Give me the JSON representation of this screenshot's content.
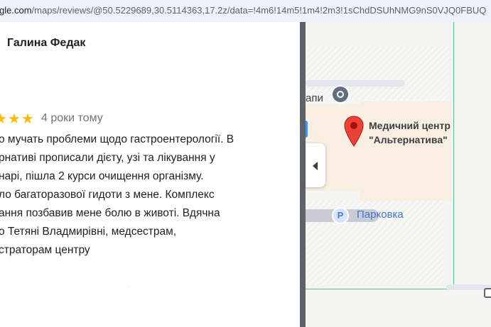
{
  "browser": {
    "url_host_part": "gle.com",
    "url_path_part": "/maps/reviews/@50.5229689,30.5114363,17.2z/data=!4m6!14m5!1m4!2m3!1sChdDSUhNMG9nS0VJQ0FBUQ"
  },
  "review": {
    "author": "Галина Федак",
    "stars": "★★★",
    "rating_icon": "star-icon",
    "date": "4 роки тому",
    "lines": [
      "о мучать проблеми щодо гастроентерології. В",
      "рнативі прописали дієту, узі та лікування у",
      "нарі, пішла 2 курси очищення організму.",
      "ло багаторазової гидоти з мене. Комплекс",
      "ання позбавив мене болю в животі. Вдячна",
      "о Тетяні Владмирівні, медсестрам,",
      "страторам центру"
    ]
  },
  "map": {
    "stop_label": "апи",
    "place_name_line1": "Медичний центр",
    "place_name_line2": "\"Альтернатива\"",
    "parking_icon_text": "P",
    "parking_label": "Парковка",
    "pin_color": "#ea4335",
    "parking_color": "#4a73d2"
  }
}
